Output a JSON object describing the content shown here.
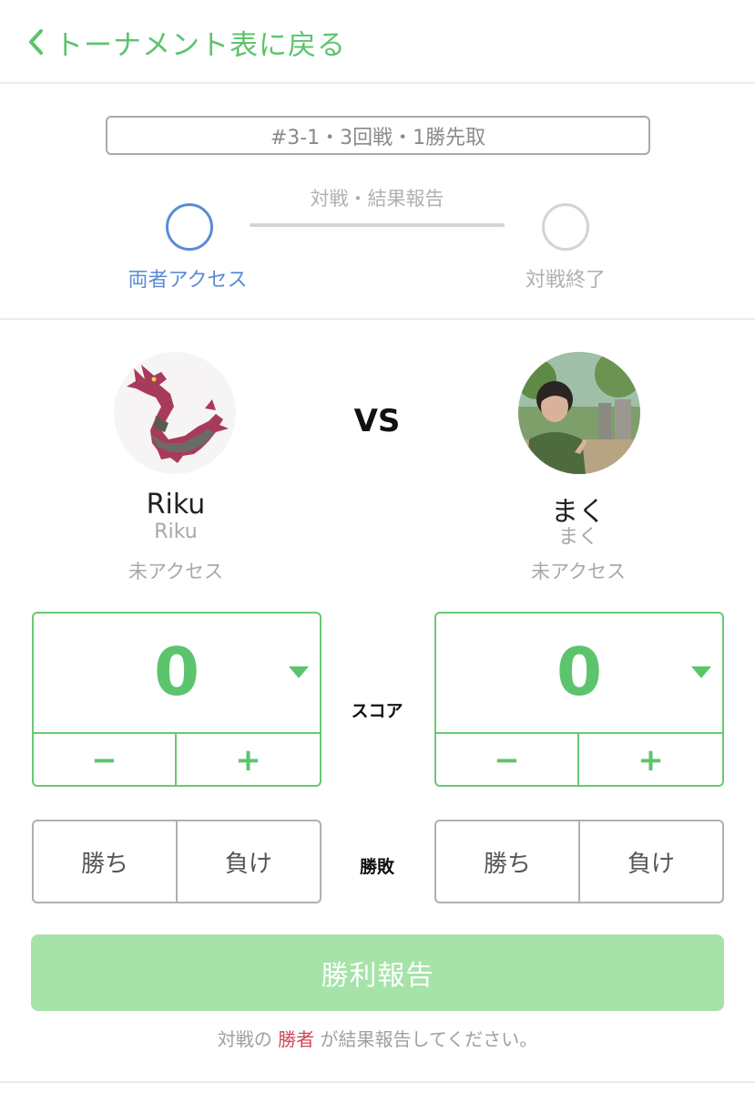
{
  "header": {
    "back_label": "トーナメント表に戻る",
    "back_icon": "chevron-left-icon"
  },
  "match": {
    "info": "#3-1・3回戦・1勝先取"
  },
  "progress": {
    "phase_label": "対戦・結果報告",
    "steps": [
      {
        "label": "両者アクセス",
        "state": "active"
      },
      {
        "label": "対戦終了",
        "state": "inactive"
      }
    ]
  },
  "vs_label": "VS",
  "players": [
    {
      "name": "Riku",
      "sub": "Riku",
      "status": "未アクセス",
      "score": "0",
      "avatar": "dragon-avatar"
    },
    {
      "name": "まく",
      "sub": "まく",
      "status": "未アクセス",
      "score": "0",
      "avatar": "user-photo-avatar"
    }
  ],
  "score_label": "スコア",
  "result_label": "勝敗",
  "buttons": {
    "minus": "−",
    "plus": "+",
    "win": "勝ち",
    "lose": "負け"
  },
  "report_button": "勝利報告",
  "note": {
    "before": "対戦の",
    "highlight": "勝者",
    "after": "が結果報告してください。"
  },
  "colors": {
    "accent_green": "#5cc46c",
    "step_blue": "#5a8cd6",
    "report_bg": "#a6e3a9",
    "winner_red": "#d1455a"
  }
}
